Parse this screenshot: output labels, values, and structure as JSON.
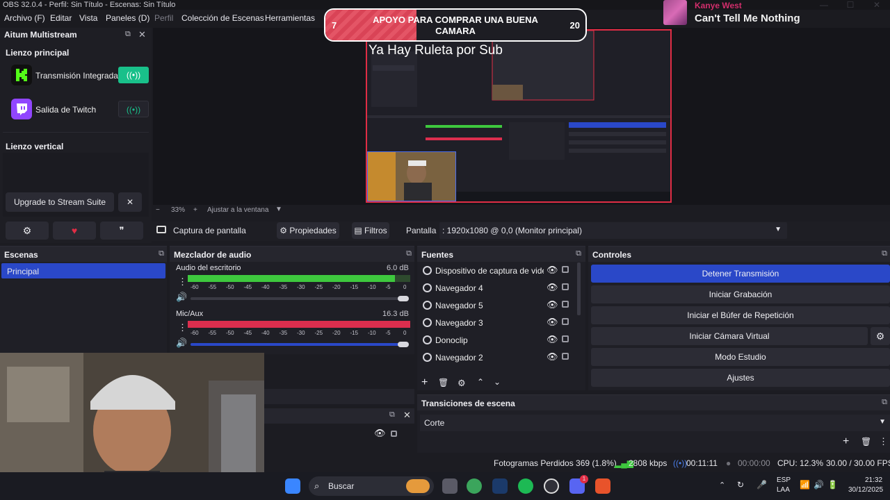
{
  "window": {
    "title": "OBS 32.0.4 - Perfil: Sin Título - Escenas: Sin Título"
  },
  "menu": [
    {
      "label": "Archivo (F)",
      "enabled": true
    },
    {
      "label": "Editar",
      "enabled": true
    },
    {
      "label": "Vista",
      "enabled": true
    },
    {
      "label": "Paneles (D)",
      "enabled": true
    },
    {
      "label": "Perfil",
      "enabled": false
    },
    {
      "label": "Colección de Escenas",
      "enabled": true
    },
    {
      "label": "Herramientas",
      "enabled": true
    }
  ],
  "overlay": {
    "donation_goal": {
      "label": "APOYO PARA COMPRAR UNA BUENA CAMARA",
      "current": "7",
      "target": "20",
      "progress_fraction": 0.35,
      "color": "#d94356"
    },
    "ruleta_text": "Ya Hay Ruleta por Sub",
    "now_playing": {
      "artist": "Kanye West",
      "song": "Can't Tell Me Nothing"
    }
  },
  "multistream": {
    "title": "Aitum Multistream",
    "main_canvas_label": "Lienzo principal",
    "outputs": [
      {
        "label": "Transmisión Integrada",
        "icon": "kick-logo-icon",
        "active": true,
        "color": "#53fc18"
      },
      {
        "label": "Salida de Twitch",
        "icon": "twitch-logo-icon",
        "active": false,
        "color": "#9146ff"
      }
    ],
    "vertical_canvas_label": "Lienzo vertical",
    "upgrade_label": "Upgrade to Stream Suite",
    "close_glyph": "✕"
  },
  "preview": {
    "zoom": "33%",
    "fit_label": "Ajustar a la ventana"
  },
  "source_toolbar": {
    "selected_source": "Captura de pantalla",
    "properties_label": "Propiedades",
    "filters_label": "Filtros",
    "display_label": "Pantalla",
    "display_value": ": 1920x1080 @ 0,0 (Monitor principal)"
  },
  "scenes": {
    "title": "Escenas",
    "items": [
      "Principal"
    ]
  },
  "mixer": {
    "title": "Mezclador de audio",
    "channels": [
      {
        "name": "Audio del escritorio",
        "db": "6.0 dB",
        "level_fraction": 0.93,
        "color": "#3ec83e"
      },
      {
        "name": "Mic/Aux",
        "db": "16.3 dB",
        "level_fraction": 1.0,
        "color": "#dc2e4e"
      }
    ],
    "ticks": [
      "-60",
      "-55",
      "-50",
      "-45",
      "-40",
      "-35",
      "-30",
      "-25",
      "-20",
      "-15",
      "-10",
      "-5",
      "0"
    ]
  },
  "sources": {
    "title": "Fuentes",
    "items": [
      "Dispositivo de captura de vide",
      "Navegador 4",
      "Navegador 5",
      "Navegador 3",
      "Donoclip",
      "Navegador 2"
    ]
  },
  "controls": {
    "title": "Controles",
    "buttons": [
      "Detener Transmisión",
      "Iniciar Grabación",
      "Iniciar el Búfer de Repetición",
      "Iniciar Cámara Virtual",
      "Modo Estudio",
      "Ajustes"
    ]
  },
  "transitions": {
    "title": "Transiciones de escena",
    "selected": "Corte"
  },
  "status": {
    "dropped": "Fotogramas Perdidos 369 (1.8%)",
    "bitrate": "2808 kbps",
    "stream_time": "00:11:11",
    "rec_time": "00:00:00",
    "cpu": "CPU: 12.3%",
    "fps": "30.00 / 30.00 FPS"
  },
  "taskbar": {
    "search_label": "Buscar",
    "lang_top": "ESP",
    "lang_bottom": "LAA",
    "time": "21:32",
    "date": "30/12/2025",
    "badge": "1"
  }
}
